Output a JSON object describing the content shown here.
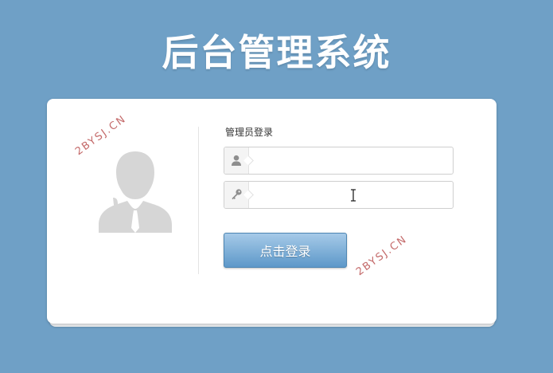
{
  "header": {
    "title": "后台管理系统"
  },
  "login": {
    "section_label": "管理员登录",
    "username": {
      "value": "",
      "icon": "user-icon"
    },
    "password": {
      "value": "",
      "icon": "key-icon"
    },
    "submit_label": "点击登录"
  },
  "avatar": {
    "icon": "user-silhouette-icon"
  },
  "watermark": {
    "text": "2BYSJ.CN"
  },
  "colors": {
    "background": "#6fa0c6",
    "panel": "#ffffff",
    "button_top": "#a6cae8",
    "button_bottom": "#5d98c9",
    "watermark": "#c46a6a"
  }
}
